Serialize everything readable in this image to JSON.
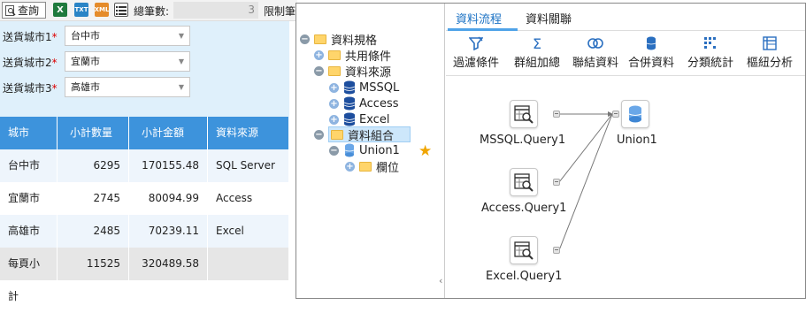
{
  "toolbar": {
    "query_label": "查詢",
    "excel_icon": "excel-icon",
    "txt_label": "TXT",
    "xml_label": "XML",
    "total_label": "總筆數:",
    "total_value": "3",
    "limit_label": "限制筆"
  },
  "filters": [
    {
      "label": "送貨城市1",
      "required": "*",
      "value": "台中市"
    },
    {
      "label": "送貨城市2",
      "required": "*",
      "value": "宜蘭市"
    },
    {
      "label": "送貨城市3",
      "required": "*",
      "value": "高雄市"
    }
  ],
  "table": {
    "headers": [
      "城市",
      "小計數量",
      "小計金額",
      "資料來源"
    ],
    "rows": [
      [
        "台中市",
        "6295",
        "170155.48",
        "SQL Server"
      ],
      [
        "宜蘭市",
        "2745",
        "80094.99",
        "Access"
      ],
      [
        "高雄市",
        "2485",
        "70239.11",
        "Excel"
      ]
    ],
    "total": [
      "每頁小計",
      "11525",
      "320489.58",
      ""
    ]
  },
  "tree": {
    "root": "資料規格",
    "shared": "共用條件",
    "sources": "資料來源",
    "mssql": "MSSQL",
    "access": "Access",
    "excel": "Excel",
    "groups": "資料組合",
    "union": "Union1",
    "field": "欄位"
  },
  "tabs": {
    "flow": "資料流程",
    "relation": "資料關聯"
  },
  "actions": {
    "filter": "過濾條件",
    "groupsum": "群組加總",
    "join": "聯結資料",
    "merge": "合併資料",
    "classify": "分類統計",
    "pivot": "樞紐分析"
  },
  "diagram": {
    "mssql_query": "MSSQL.Query1",
    "access_query": "Access.Query1",
    "excel_query": "Excel.Query1",
    "union": "Union1"
  },
  "colors": {
    "accent": "#3d93dc",
    "filter_bg": "#dff0fb",
    "tab_active": "#1b72c4",
    "star": "#f0a500"
  }
}
